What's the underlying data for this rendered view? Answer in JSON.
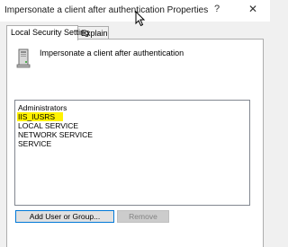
{
  "window": {
    "title": "Impersonate a client after authentication Properties",
    "help_glyph": "?",
    "close_glyph": "✕"
  },
  "tabs": [
    {
      "label": "Local Security Setting",
      "active": true
    },
    {
      "label": "Explain",
      "active": false
    }
  ],
  "policy": {
    "name": "Impersonate a client after authentication",
    "icon": "server-policy-icon"
  },
  "accounts": [
    {
      "label": "Administrators",
      "highlighted": false
    },
    {
      "label": "IIS_IUSRS",
      "highlighted": true
    },
    {
      "label": "LOCAL SERVICE",
      "highlighted": false
    },
    {
      "label": "NETWORK SERVICE",
      "highlighted": false
    },
    {
      "label": "SERVICE",
      "highlighted": false
    }
  ],
  "buttons": {
    "add_label": "Add User or Group...",
    "remove_label": "Remove",
    "remove_enabled": false
  },
  "colors": {
    "highlight": "#fff200",
    "focus_border": "#0078d7"
  }
}
